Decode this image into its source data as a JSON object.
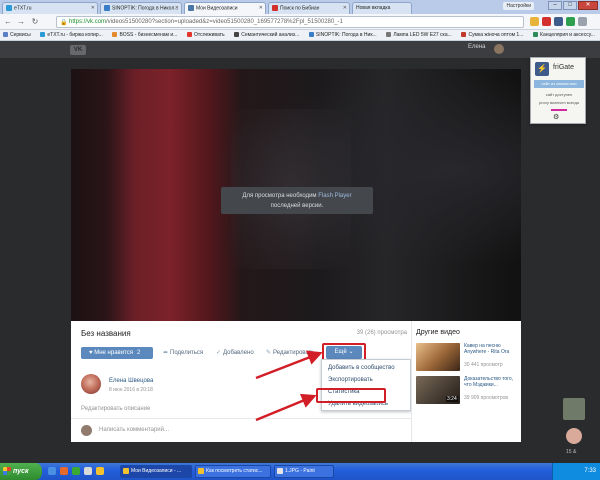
{
  "browser": {
    "tabs": [
      {
        "title": "eTXT.ru",
        "icon_color": "#2b9bd8"
      },
      {
        "title": "SINOPTIK: Погода в Никол...",
        "icon_color": "#3a7dc9"
      },
      {
        "title": "Мои Видеозаписи",
        "icon_color": "#4a76a8"
      },
      {
        "title": "Поиск по Бибиан",
        "icon_color": "#d2302b"
      },
      {
        "title": "Новая вкладка",
        "icon_color": "#cccccc"
      }
    ],
    "active_tab": 2,
    "window_label": "Настройки",
    "url_host": "https://vk.com",
    "url_path": "/videos51500280?section=uploaded&z=video51500280_169577278%2Fpl_51500280_-1",
    "bookmarks": [
      {
        "label": "Сервисы",
        "color": "#5a7fc4"
      },
      {
        "label": "eTXT.ru - биржа копир...",
        "color": "#2b9bd8"
      },
      {
        "label": "BOSS - бизнесменам и...",
        "color": "#e38b2c"
      },
      {
        "label": "Отслеживать",
        "color": "#e2352c"
      },
      {
        "label": "Семантический анализ...",
        "color": "#444444"
      },
      {
        "label": "SINOPTIK: Погода в Ник...",
        "color": "#3a7dc9"
      },
      {
        "label": "Лампа LED 5W E27 ска...",
        "color": "#777777"
      },
      {
        "label": "Сумка жіноча оптом 1...",
        "color": "#c0392b"
      },
      {
        "label": "Канцелярия и аксессу...",
        "color": "#2e8b57"
      }
    ]
  },
  "vk": {
    "logo": "VK",
    "user_name": "Елена"
  },
  "player": {
    "flash_line1": "Для просмотра необходим",
    "flash_link": "Flash Player",
    "flash_line2": "последней версии."
  },
  "video": {
    "title": "Без названия",
    "views": "39 (26) просмотра",
    "like_label": "Мне нравится",
    "like_count": "2",
    "share_label": "Поделиться",
    "added_label": "Добавлено",
    "edit_label": "Редактировать",
    "more_label": "Ещё",
    "menu": [
      "Добавить в сообщество",
      "Экспортировать",
      "Статистика",
      "Удалить видеозапись"
    ],
    "author_name": "Елена Швецова",
    "author_date": "8 июн 2016 в 20:18",
    "edit_description": "Редактировать описание",
    "comment_placeholder": "Написать комментарий..."
  },
  "sidebar": {
    "title": "Другие видео",
    "items": [
      {
        "title": "Кавер на песню Anywhere - Rita Ora",
        "count": "30 441 просмотр",
        "duration": "",
        "thumb": "#a06a3a"
      },
      {
        "title": "Доказательство того, что Мэджики...",
        "count": "39 909 просмотров",
        "duration": "3:24",
        "thumb": "#4d4238"
      }
    ]
  },
  "frigate": {
    "name": "friGate",
    "status": "сайт из списка или",
    "line2": "сайт доступен",
    "line3": "proxy включен всегда"
  },
  "taskbar": {
    "start_label": "пуск",
    "tasks": [
      "Мои Видеозаписи - ...",
      "Как посмотреть статис...",
      "1.JPG - Paint"
    ],
    "clock": "7:33",
    "chat_count": "15 &"
  }
}
